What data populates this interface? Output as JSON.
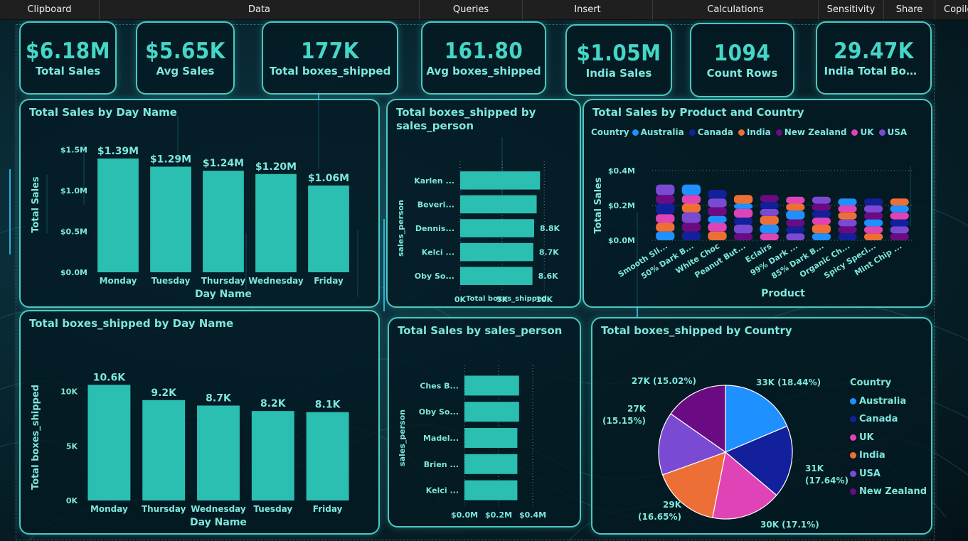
{
  "ribbon": {
    "items": [
      "Clipboard",
      "Data",
      "Queries",
      "Insert",
      "Calculations",
      "Sensitivity",
      "Share",
      "Copilot"
    ]
  },
  "kpis": [
    {
      "value": "$6.18M",
      "label": "Total Sales"
    },
    {
      "value": "$5.65K",
      "label": "Avg Sales"
    },
    {
      "value": "177K",
      "label": "Total boxes_shipped"
    },
    {
      "value": "161.80",
      "label": "Avg boxes_shipped"
    },
    {
      "value": "$1.05M",
      "label": "India Sales"
    },
    {
      "value": "1094",
      "label": "Count Rows"
    },
    {
      "value": "29.47K",
      "label": "India Total Boxes shipped"
    }
  ],
  "colors": {
    "accent": "#46d6c8",
    "bar": "#2bbfb1",
    "Australia": "#1e90ff",
    "Canada": "#13209c",
    "India": "#ee6f35",
    "New Zealand": "#6b0b83",
    "UK": "#e043b5",
    "USA": "#7a4ad3"
  },
  "chart_data": [
    {
      "id": "sales_by_day",
      "type": "bar",
      "title": "Total Sales by Day Name",
      "xlabel": "Day Name",
      "ylabel": "Total Sales",
      "categories": [
        "Monday",
        "Tuesday",
        "Thursday",
        "Wednesday",
        "Friday"
      ],
      "values": [
        1.39,
        1.29,
        1.24,
        1.2,
        1.06
      ],
      "data_labels": [
        "$1.39M",
        "$1.29M",
        "$1.24M",
        "$1.20M",
        "$1.06M"
      ],
      "yticks": [
        0,
        0.5,
        1.0,
        1.5
      ],
      "ytick_labels": [
        "$0.0M",
        "$0.5M",
        "$1.0M",
        "$1.5M"
      ],
      "ylim": [
        0,
        1.65
      ]
    },
    {
      "id": "boxes_by_salesperson",
      "type": "bar",
      "orientation": "horizontal",
      "title": "Total boxes_shipped by sales_person",
      "xlabel": "Total boxes_shipped",
      "ylabel": "sales_person",
      "categories": [
        "Karlen ...",
        "Beveri...",
        "Dennis...",
        "Kelci ...",
        "Oby So..."
      ],
      "values": [
        9.5,
        9.1,
        8.8,
        8.7,
        8.6
      ],
      "data_labels": [
        "",
        "",
        "8.8K",
        "8.7K",
        "8.6K"
      ],
      "xticks": [
        0,
        5,
        10
      ],
      "xtick_labels": [
        "0K",
        "5K",
        "10K"
      ],
      "xlim": [
        0,
        11
      ]
    },
    {
      "id": "sales_by_product_country",
      "type": "bar",
      "stacked": true,
      "title": "Total Sales by Product and Country",
      "xlabel": "Product",
      "ylabel": "Total Sales",
      "legend_title": "Country",
      "legend": [
        "Australia",
        "Canada",
        "India",
        "New Zealand",
        "UK",
        "USA"
      ],
      "categories": [
        "Smooth Sli...",
        "50% Dark B...",
        "White Choc",
        "Peanut But...",
        "Eclairs",
        "99% Dark ...",
        "85% Dark B...",
        "Organic Ch...",
        "Spicy Speci...",
        "Mint Chip ..."
      ],
      "yticks": [
        0,
        0.2,
        0.4
      ],
      "ytick_labels": [
        "$0.0M",
        "$0.2M",
        "$0.4M"
      ],
      "ylim": [
        0,
        0.4
      ],
      "series": [
        {
          "name": "Australia",
          "values": [
            0.05,
            0.06,
            0.04,
            0.03,
            0.05,
            0.05,
            0.04,
            0.04,
            0.04,
            0.04
          ]
        },
        {
          "name": "Canada",
          "values": [
            0.06,
            0.05,
            0.05,
            0.04,
            0.04,
            0.04,
            0.04,
            0.04,
            0.04,
            0.04
          ]
        },
        {
          "name": "India",
          "values": [
            0.05,
            0.05,
            0.05,
            0.05,
            0.05,
            0.04,
            0.05,
            0.04,
            0.04,
            0.04
          ]
        },
        {
          "name": "New Zealand",
          "values": [
            0.05,
            0.05,
            0.05,
            0.04,
            0.04,
            0.04,
            0.04,
            0.04,
            0.04,
            0.04
          ]
        },
        {
          "name": "UK",
          "values": [
            0.05,
            0.05,
            0.05,
            0.05,
            0.04,
            0.04,
            0.04,
            0.04,
            0.04,
            0.04
          ]
        },
        {
          "name": "USA",
          "values": [
            0.06,
            0.06,
            0.05,
            0.05,
            0.04,
            0.04,
            0.04,
            0.04,
            0.04,
            0.04
          ]
        }
      ]
    },
    {
      "id": "boxes_by_day",
      "type": "bar",
      "title": "Total boxes_shipped by Day Name",
      "xlabel": "Day Name",
      "ylabel": "Total boxes_shipped",
      "categories": [
        "Monday",
        "Thursday",
        "Wednesday",
        "Tuesday",
        "Friday"
      ],
      "values": [
        10.6,
        9.2,
        8.7,
        8.2,
        8.1
      ],
      "data_labels": [
        "10.6K",
        "9.2K",
        "8.7K",
        "8.2K",
        "8.1K"
      ],
      "yticks": [
        0,
        5,
        10
      ],
      "ytick_labels": [
        "0K",
        "5K",
        "10K"
      ],
      "ylim": [
        0,
        11.6
      ]
    },
    {
      "id": "sales_by_salesperson",
      "type": "bar",
      "orientation": "horizontal",
      "title": "Total Sales by sales_person",
      "xlabel": "Total Sales",
      "ylabel": "sales_person",
      "categories": [
        "Ches B...",
        "Oby So...",
        "Madel...",
        "Brien ...",
        "Kelci ..."
      ],
      "values": [
        0.32,
        0.32,
        0.31,
        0.31,
        0.31
      ],
      "xticks": [
        0,
        0.2,
        0.4
      ],
      "xtick_labels": [
        "$0.0M",
        "$0.2M",
        "$0.4M"
      ],
      "xlim": [
        0,
        0.45
      ]
    },
    {
      "id": "boxes_by_country",
      "type": "pie",
      "title": "Total boxes_shipped by Country",
      "legend_title": "Country",
      "legend": [
        "Australia",
        "Canada",
        "UK",
        "India",
        "USA",
        "New Zealand"
      ],
      "slices": [
        {
          "name": "Australia",
          "value": 33,
          "label": "33K (18.44%)"
        },
        {
          "name": "Canada",
          "value": 31,
          "label": "31K (17.64%)"
        },
        {
          "name": "UK",
          "value": 30,
          "label": "30K (17.1%)"
        },
        {
          "name": "India",
          "value": 29,
          "label": "29K (16.65%)"
        },
        {
          "name": "USA",
          "value": 27,
          "label": "27K (15.15%)"
        },
        {
          "name": "New Zealand",
          "value": 27,
          "label": "27K (15.02%)"
        }
      ]
    }
  ]
}
